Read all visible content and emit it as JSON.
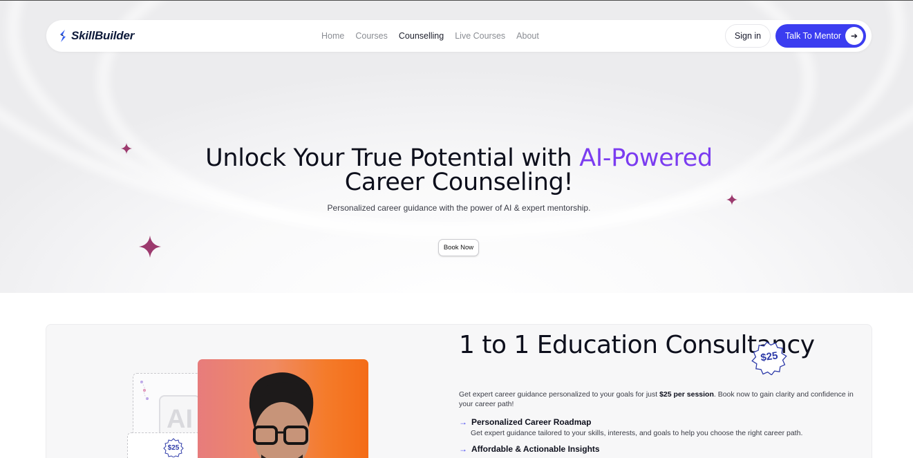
{
  "navbar": {
    "brand": "SkillBuilder",
    "links": [
      "Home",
      "Courses",
      "Counselling",
      "Live Courses",
      "About"
    ],
    "active_link": "Counselling",
    "signin_label": "Sign in",
    "cta_label": "Talk To Mentor"
  },
  "hero": {
    "title_part1": "Unlock Your True Potential with ",
    "title_accent": "AI-Powered",
    "title_part2": "Career Counseling!",
    "subtitle": "Personalized career guidance with the power of AI & expert mentorship.",
    "button_label": "Book Now"
  },
  "consultancy": {
    "title": "1 to 1 Education Consultancy",
    "price_badge": "$25",
    "illustration_badge": "$25",
    "illustration_text": "AI",
    "desc_before": "Get expert career guidance personalized to your goals for just ",
    "desc_bold": "$25 per session",
    "desc_after": ". Book now to gain clarity and confidence in your career path!",
    "features": [
      {
        "title": "Personalized Career Roadmap",
        "desc": "Get expert guidance tailored to your skills, interests, and goals to help you choose the right career path."
      },
      {
        "title": "Affordable & Actionable Insights",
        "desc": ""
      }
    ]
  },
  "colors": {
    "accent_purple": "#7b3cf0",
    "cta_blue": "#3b3df0",
    "sparkle": "#9c3a6e"
  }
}
